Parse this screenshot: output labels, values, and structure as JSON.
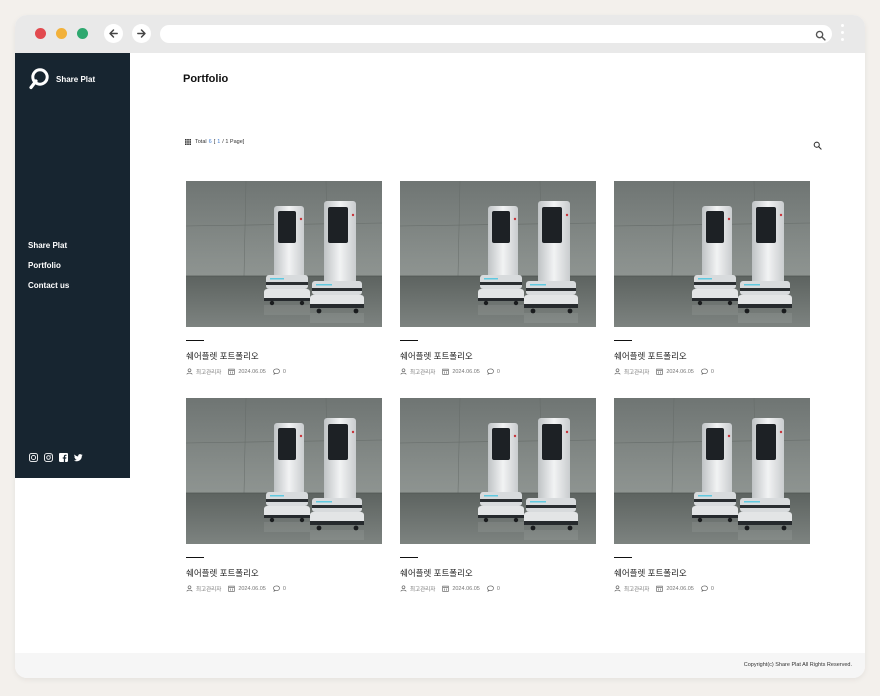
{
  "browser": {
    "url": "",
    "icons": {
      "back": "arrow-left-icon",
      "forward": "arrow-right-icon",
      "search": "search-icon",
      "menu": "kebab-menu-icon"
    }
  },
  "sidebar": {
    "logo_text": "Share Plat",
    "menu": [
      "Share Plat",
      "Portfolio",
      "Contact us"
    ],
    "social": [
      "circle-icon",
      "instagram-icon",
      "facebook-icon",
      "twitter-icon"
    ],
    "bg_color": "#172530"
  },
  "page": {
    "title": "Portfolio",
    "total_label": "Total",
    "total_count": "6",
    "page_info_open": "[",
    "page_current": "1",
    "page_info_rest": "/ 1 Page]"
  },
  "posts": [
    {
      "title": "쉐어플렛 포트폴리오",
      "author": "최고관리자",
      "date": "2024.06.05",
      "comments": "0"
    },
    {
      "title": "쉐어플렛 포트폴리오",
      "author": "최고관리자",
      "date": "2024.06.05",
      "comments": "0"
    },
    {
      "title": "쉐어플렛 포트폴리오",
      "author": "최고관리자",
      "date": "2024.06.05",
      "comments": "0"
    },
    {
      "title": "쉐어플렛 포트폴리오",
      "author": "최고관리자",
      "date": "2024.06.05",
      "comments": "0"
    },
    {
      "title": "쉐어플렛 포트폴리오",
      "author": "최고관리자",
      "date": "2024.06.05",
      "comments": "0"
    },
    {
      "title": "쉐어플렛 포트폴리오",
      "author": "최고관리자",
      "date": "2024.06.05",
      "comments": "0"
    }
  ],
  "footer": {
    "copyright": "Copyright(c) Share Plat All Rights Reserved."
  }
}
